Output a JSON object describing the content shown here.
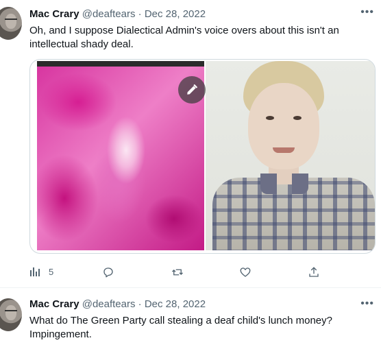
{
  "tweets": [
    {
      "author": {
        "name": "Mac Crary",
        "handle": "@deaftears"
      },
      "separator": "·",
      "date": "Dec 28, 2022",
      "more_label": "•••",
      "text": "Oh, and I suppose Dialectical Admin's voice overs about this isn't an intellectual shady deal.",
      "media": {
        "left_image": "pixelated pink close-up",
        "right_image": "vintage photo of smiling boy in plaid shirt",
        "edit_icon": "pencil-icon"
      },
      "actions": {
        "views_count": "5"
      }
    },
    {
      "author": {
        "name": "Mac Crary",
        "handle": "@deaftears"
      },
      "separator": "·",
      "date": "Dec 28, 2022",
      "more_label": "•••",
      "text_line1": "What do The Green Party call stealing a deaf child's lunch money?",
      "text_line2": "Impingement."
    }
  ],
  "colors": {
    "secondary_text": "#536471",
    "primary_text": "#0f1419",
    "border": "#cfd9de"
  }
}
